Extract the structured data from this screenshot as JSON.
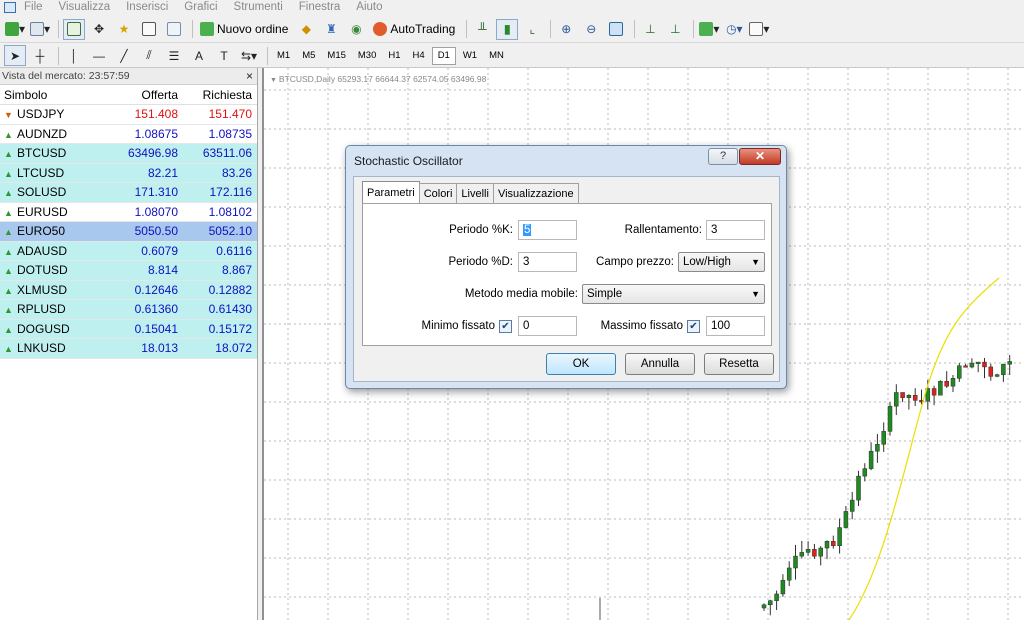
{
  "menu": [
    "File",
    "Visualizza",
    "Inserisci",
    "Grafici",
    "Strumenti",
    "Finestra",
    "Aiuto"
  ],
  "toolbar": {
    "new_order": "Nuovo ordine",
    "autotrading": "AutoTrading",
    "periods": [
      "M1",
      "M5",
      "M15",
      "M30",
      "H1",
      "H4",
      "D1",
      "W1",
      "MN"
    ],
    "active_period": "D1",
    "text_tool": "A"
  },
  "market_watch": {
    "title": "Vista del mercato: 23:57:59",
    "close": "×",
    "headers": {
      "symbol": "Simbolo",
      "bid": "Offerta",
      "ask": "Richiesta"
    },
    "rows": [
      {
        "symbol": "USDJPY",
        "bid": "151.408",
        "ask": "151.470",
        "dir": "down",
        "style": "plain"
      },
      {
        "symbol": "AUDNZD",
        "bid": "1.08675",
        "ask": "1.08735",
        "dir": "up",
        "style": "plain"
      },
      {
        "symbol": "BTCUSD",
        "bid": "63496.98",
        "ask": "63511.06",
        "dir": "up",
        "style": "cyan"
      },
      {
        "symbol": "LTCUSD",
        "bid": "82.21",
        "ask": "83.26",
        "dir": "up",
        "style": "cyan"
      },
      {
        "symbol": "SOLUSD",
        "bid": "171.310",
        "ask": "172.116",
        "dir": "up",
        "style": "cyan"
      },
      {
        "symbol": "EURUSD",
        "bid": "1.08070",
        "ask": "1.08102",
        "dir": "up",
        "style": "plain"
      },
      {
        "symbol": "EURO50",
        "bid": "5050.50",
        "ask": "5052.10",
        "dir": "up",
        "style": "selected"
      },
      {
        "symbol": "ADAUSD",
        "bid": "0.6079",
        "ask": "0.6116",
        "dir": "up",
        "style": "cyan"
      },
      {
        "symbol": "DOTUSD",
        "bid": "8.814",
        "ask": "8.867",
        "dir": "up",
        "style": "cyan"
      },
      {
        "symbol": "XLMUSD",
        "bid": "0.12646",
        "ask": "0.12882",
        "dir": "up",
        "style": "cyan"
      },
      {
        "symbol": "RPLUSD",
        "bid": "0.61360",
        "ask": "0.61430",
        "dir": "up",
        "style": "cyan"
      },
      {
        "symbol": "DOGUSD",
        "bid": "0.15041",
        "ask": "0.15172",
        "dir": "up",
        "style": "cyan"
      },
      {
        "symbol": "LNKUSD",
        "bid": "18.013",
        "ask": "18.072",
        "dir": "up",
        "style": "cyan"
      }
    ]
  },
  "chart": {
    "title": "BTCUSD,Daily  65293.17 66644.37 62574.05 63496.98",
    "colors": {
      "bull": "#1f8a1f",
      "bear": "#e02020",
      "wick": "#303030",
      "ma": "#e8e000",
      "grid": "#b8b8b8"
    }
  },
  "dialog": {
    "title": "Stochastic Oscillator",
    "help": "?",
    "close": "✕",
    "tabs": [
      "Parametri",
      "Colori",
      "Livelli",
      "Visualizzazione"
    ],
    "active_tab": "Parametri",
    "k_period_label": "Periodo %K:",
    "k_period": "5",
    "d_period_label": "Periodo %D:",
    "d_period": "3",
    "slowing_label": "Rallentamento:",
    "slowing": "3",
    "price_field_label": "Campo prezzo:",
    "price_field": "Low/High",
    "ma_method_label": "Metodo media mobile:",
    "ma_method": "Simple",
    "fixed_min_label": "Minimo fissato",
    "fixed_min": "0",
    "fixed_max_label": "Massimo fissato",
    "fixed_max": "100",
    "ok": "OK",
    "cancel": "Annulla",
    "reset": "Resetta"
  }
}
